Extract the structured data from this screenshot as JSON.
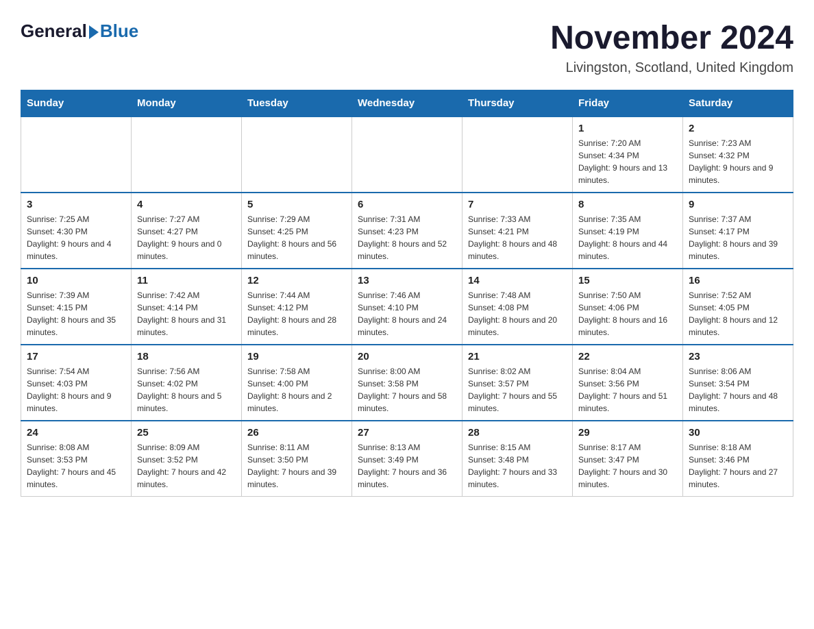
{
  "header": {
    "logo_general": "General",
    "logo_blue": "Blue",
    "month_title": "November 2024",
    "location": "Livingston, Scotland, United Kingdom"
  },
  "days_of_week": [
    "Sunday",
    "Monday",
    "Tuesday",
    "Wednesday",
    "Thursday",
    "Friday",
    "Saturday"
  ],
  "weeks": [
    {
      "days": [
        {
          "number": "",
          "info": "",
          "empty": true
        },
        {
          "number": "",
          "info": "",
          "empty": true
        },
        {
          "number": "",
          "info": "",
          "empty": true
        },
        {
          "number": "",
          "info": "",
          "empty": true
        },
        {
          "number": "",
          "info": "",
          "empty": true
        },
        {
          "number": "1",
          "info": "Sunrise: 7:20 AM\nSunset: 4:34 PM\nDaylight: 9 hours and 13 minutes."
        },
        {
          "number": "2",
          "info": "Sunrise: 7:23 AM\nSunset: 4:32 PM\nDaylight: 9 hours and 9 minutes."
        }
      ]
    },
    {
      "days": [
        {
          "number": "3",
          "info": "Sunrise: 7:25 AM\nSunset: 4:30 PM\nDaylight: 9 hours and 4 minutes."
        },
        {
          "number": "4",
          "info": "Sunrise: 7:27 AM\nSunset: 4:27 PM\nDaylight: 9 hours and 0 minutes."
        },
        {
          "number": "5",
          "info": "Sunrise: 7:29 AM\nSunset: 4:25 PM\nDaylight: 8 hours and 56 minutes."
        },
        {
          "number": "6",
          "info": "Sunrise: 7:31 AM\nSunset: 4:23 PM\nDaylight: 8 hours and 52 minutes."
        },
        {
          "number": "7",
          "info": "Sunrise: 7:33 AM\nSunset: 4:21 PM\nDaylight: 8 hours and 48 minutes."
        },
        {
          "number": "8",
          "info": "Sunrise: 7:35 AM\nSunset: 4:19 PM\nDaylight: 8 hours and 44 minutes."
        },
        {
          "number": "9",
          "info": "Sunrise: 7:37 AM\nSunset: 4:17 PM\nDaylight: 8 hours and 39 minutes."
        }
      ]
    },
    {
      "days": [
        {
          "number": "10",
          "info": "Sunrise: 7:39 AM\nSunset: 4:15 PM\nDaylight: 8 hours and 35 minutes."
        },
        {
          "number": "11",
          "info": "Sunrise: 7:42 AM\nSunset: 4:14 PM\nDaylight: 8 hours and 31 minutes."
        },
        {
          "number": "12",
          "info": "Sunrise: 7:44 AM\nSunset: 4:12 PM\nDaylight: 8 hours and 28 minutes."
        },
        {
          "number": "13",
          "info": "Sunrise: 7:46 AM\nSunset: 4:10 PM\nDaylight: 8 hours and 24 minutes."
        },
        {
          "number": "14",
          "info": "Sunrise: 7:48 AM\nSunset: 4:08 PM\nDaylight: 8 hours and 20 minutes."
        },
        {
          "number": "15",
          "info": "Sunrise: 7:50 AM\nSunset: 4:06 PM\nDaylight: 8 hours and 16 minutes."
        },
        {
          "number": "16",
          "info": "Sunrise: 7:52 AM\nSunset: 4:05 PM\nDaylight: 8 hours and 12 minutes."
        }
      ]
    },
    {
      "days": [
        {
          "number": "17",
          "info": "Sunrise: 7:54 AM\nSunset: 4:03 PM\nDaylight: 8 hours and 9 minutes."
        },
        {
          "number": "18",
          "info": "Sunrise: 7:56 AM\nSunset: 4:02 PM\nDaylight: 8 hours and 5 minutes."
        },
        {
          "number": "19",
          "info": "Sunrise: 7:58 AM\nSunset: 4:00 PM\nDaylight: 8 hours and 2 minutes."
        },
        {
          "number": "20",
          "info": "Sunrise: 8:00 AM\nSunset: 3:58 PM\nDaylight: 7 hours and 58 minutes."
        },
        {
          "number": "21",
          "info": "Sunrise: 8:02 AM\nSunset: 3:57 PM\nDaylight: 7 hours and 55 minutes."
        },
        {
          "number": "22",
          "info": "Sunrise: 8:04 AM\nSunset: 3:56 PM\nDaylight: 7 hours and 51 minutes."
        },
        {
          "number": "23",
          "info": "Sunrise: 8:06 AM\nSunset: 3:54 PM\nDaylight: 7 hours and 48 minutes."
        }
      ]
    },
    {
      "days": [
        {
          "number": "24",
          "info": "Sunrise: 8:08 AM\nSunset: 3:53 PM\nDaylight: 7 hours and 45 minutes."
        },
        {
          "number": "25",
          "info": "Sunrise: 8:09 AM\nSunset: 3:52 PM\nDaylight: 7 hours and 42 minutes."
        },
        {
          "number": "26",
          "info": "Sunrise: 8:11 AM\nSunset: 3:50 PM\nDaylight: 7 hours and 39 minutes."
        },
        {
          "number": "27",
          "info": "Sunrise: 8:13 AM\nSunset: 3:49 PM\nDaylight: 7 hours and 36 minutes."
        },
        {
          "number": "28",
          "info": "Sunrise: 8:15 AM\nSunset: 3:48 PM\nDaylight: 7 hours and 33 minutes."
        },
        {
          "number": "29",
          "info": "Sunrise: 8:17 AM\nSunset: 3:47 PM\nDaylight: 7 hours and 30 minutes."
        },
        {
          "number": "30",
          "info": "Sunrise: 8:18 AM\nSunset: 3:46 PM\nDaylight: 7 hours and 27 minutes."
        }
      ]
    }
  ]
}
